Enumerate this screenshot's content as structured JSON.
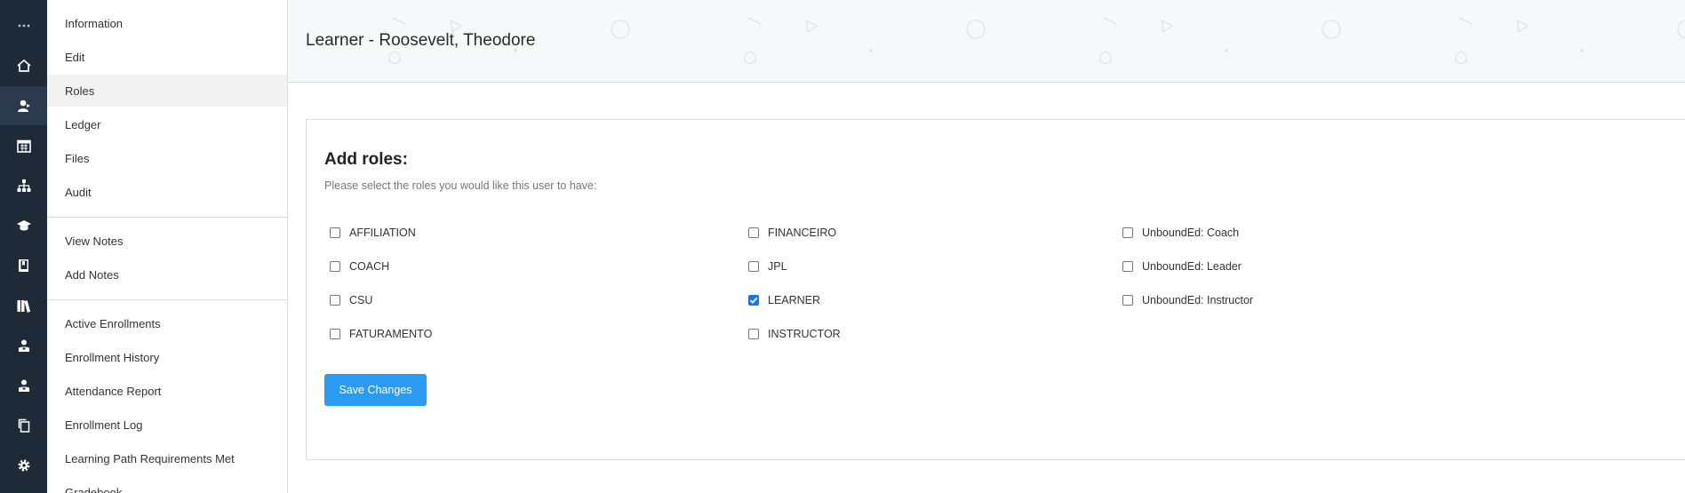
{
  "rail": {
    "icons": [
      "more-icon",
      "home-icon",
      "users-icon",
      "calendar-icon",
      "sitemap-icon",
      "graduation-cap-icon",
      "book-icon",
      "library-icon",
      "user-badge-icon",
      "user-badge-icon-2",
      "copy-icon",
      "gear-icon"
    ],
    "active": "users-icon"
  },
  "subnav": {
    "items": [
      {
        "label": "Information"
      },
      {
        "label": "Edit"
      },
      {
        "label": "Roles"
      },
      {
        "label": "Ledger"
      },
      {
        "label": "Files"
      },
      {
        "label": "Audit"
      },
      {
        "label": "View Notes"
      },
      {
        "label": "Add Notes"
      },
      {
        "label": "Active Enrollments"
      },
      {
        "label": "Enrollment History"
      },
      {
        "label": "Attendance Report"
      },
      {
        "label": "Enrollment Log"
      },
      {
        "label": "Learning Path Requirements Met"
      },
      {
        "label": "Gradebook"
      }
    ],
    "active": "Roles"
  },
  "header": {
    "title": "Learner - Roosevelt, Theodore"
  },
  "roles_card": {
    "title": "Add roles:",
    "subtitle": "Please select the roles you would like this user to have:",
    "columns": [
      [
        {
          "label": "AFFILIATION",
          "checked": false
        },
        {
          "label": "COACH",
          "checked": false
        },
        {
          "label": "CSU",
          "checked": false
        },
        {
          "label": "FATURAMENTO",
          "checked": false
        }
      ],
      [
        {
          "label": "FINANCEIRO",
          "checked": false
        },
        {
          "label": "JPL",
          "checked": false
        },
        {
          "label": "LEARNER",
          "checked": true
        },
        {
          "label": "INSTRUCTOR",
          "checked": false
        }
      ],
      [
        {
          "label": "UnboundEd: Coach",
          "checked": false
        },
        {
          "label": "UnboundEd: Leader",
          "checked": false
        },
        {
          "label": "UnboundEd: Instructor",
          "checked": false
        }
      ]
    ],
    "save_label": "Save Changes"
  },
  "colors": {
    "rail_bg": "#1e2a38",
    "accent": "#2a9bf0",
    "checkbox_checked": "#1a73e8"
  }
}
